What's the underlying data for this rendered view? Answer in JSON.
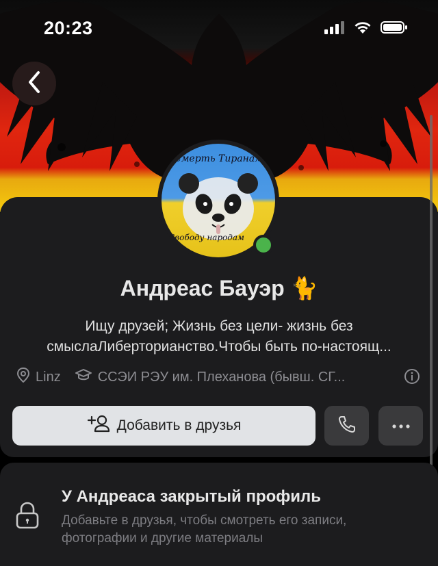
{
  "status_bar": {
    "time": "20:23",
    "signal_icon": "cellular-signal-icon",
    "wifi_icon": "wifi-icon",
    "battery_icon": "battery-icon"
  },
  "header": {
    "back_icon": "chevron-left-icon"
  },
  "cover": {
    "description_icon": "eagle-cover-image"
  },
  "avatar": {
    "top_text": "Смерть Тиранам",
    "bottom_text": "Свободу народам",
    "online": true
  },
  "profile": {
    "name": "Андреас Бауэр 🐈",
    "status": "Ищу друзей; Жизнь без цели- жизнь без смыслаЛиберторианство.Чтобы быть по-настоящ...",
    "city": "Linz",
    "education": "ССЭИ РЭУ им. Плеханова (бывш. СГ..."
  },
  "actions": {
    "add_friend_label": "Добавить в друзья",
    "call_icon": "phone-icon",
    "more_icon": "more-horizontal-icon"
  },
  "private_notice": {
    "title": "У Андреаса закрытый профиль",
    "description": "Добавьте в друзья, чтобы смотреть его записи, фотографии и другие материалы"
  },
  "colors": {
    "card_bg": "#1c1c1e",
    "accent_online": "#4bb34b",
    "button_light": "#e1e3e6",
    "button_dark": "#3a3a3c"
  }
}
